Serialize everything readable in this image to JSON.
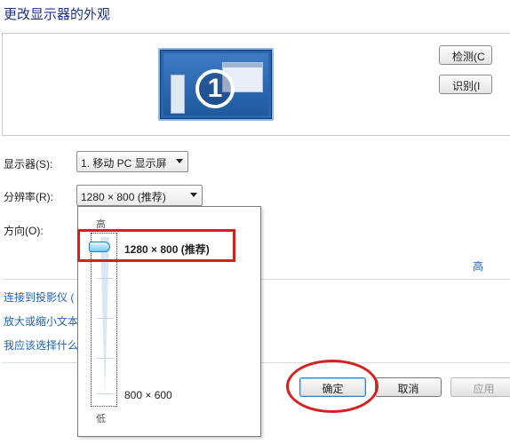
{
  "page_title": "更改显示器的外观",
  "preview": {
    "monitor_number": "1",
    "detect_button": "检测(C",
    "identify_button": "识别(I"
  },
  "display_label": "显示器(S):",
  "display_value": "1. 移动 PC 显示屏",
  "resolution_label": "分辨率(R):",
  "resolution_value": "1280 × 800 (推荐)",
  "orientation_label": "方向(O):",
  "resolution_dropdown": {
    "high_label": "高",
    "low_label": "低",
    "top_option": "1280 × 800 (推荐)",
    "bottom_option": "800 × 600",
    "slider_level": 1.0
  },
  "advanced_link": "高",
  "links": [
    "连接到投影仪 (",
    "放大或缩小文本",
    "我应该选择什么"
  ],
  "buttons": {
    "ok": "确定",
    "cancel": "取消",
    "apply": "应用"
  },
  "highlight_color": "#d62020",
  "link_color": "#1f62b6"
}
